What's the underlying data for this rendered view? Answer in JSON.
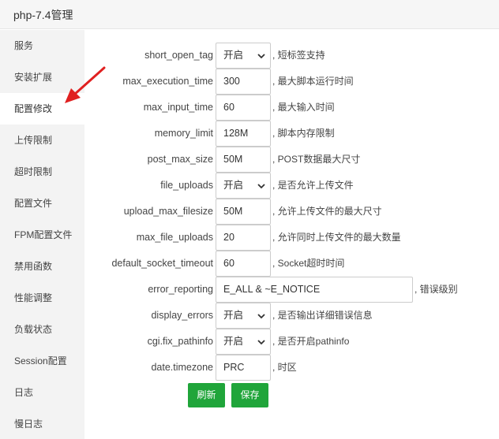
{
  "window": {
    "title": "php-7.4管理"
  },
  "sidebar": {
    "items": [
      {
        "label": "服务"
      },
      {
        "label": "安装扩展"
      },
      {
        "label": "配置修改"
      },
      {
        "label": "上传限制"
      },
      {
        "label": "超时限制"
      },
      {
        "label": "配置文件"
      },
      {
        "label": "FPM配置文件"
      },
      {
        "label": "禁用函数"
      },
      {
        "label": "性能调整"
      },
      {
        "label": "负载状态"
      },
      {
        "label": "Session配置"
      },
      {
        "label": "日志"
      },
      {
        "label": "慢日志"
      }
    ],
    "active_index": 2
  },
  "settings": [
    {
      "key": "short_open_tag",
      "value": "开启",
      "type": "select",
      "note": "短标签支持"
    },
    {
      "key": "max_execution_time",
      "value": "300",
      "type": "input",
      "note": "最大脚本运行时间"
    },
    {
      "key": "max_input_time",
      "value": "60",
      "type": "input",
      "note": "最大输入时间"
    },
    {
      "key": "memory_limit",
      "value": "128M",
      "type": "input",
      "note": "脚本内存限制"
    },
    {
      "key": "post_max_size",
      "value": "50M",
      "type": "input",
      "note": "POST数据最大尺寸"
    },
    {
      "key": "file_uploads",
      "value": "开启",
      "type": "select",
      "note": "是否允许上传文件"
    },
    {
      "key": "upload_max_filesize",
      "value": "50M",
      "type": "input",
      "note": "允许上传文件的最大尺寸"
    },
    {
      "key": "max_file_uploads",
      "value": "20",
      "type": "input",
      "note": "允许同时上传文件的最大数量"
    },
    {
      "key": "default_socket_timeout",
      "value": "60",
      "type": "input",
      "note": "Socket超时时间"
    },
    {
      "key": "error_reporting",
      "value": "E_ALL & ~E_NOTICE",
      "type": "wide",
      "note": "错误级别"
    },
    {
      "key": "display_errors",
      "value": "开启",
      "type": "select",
      "note": "是否输出详细错误信息"
    },
    {
      "key": "cgi.fix_pathinfo",
      "value": "开启",
      "type": "select",
      "note": "是否开启pathinfo"
    },
    {
      "key": "date.timezone",
      "value": "PRC",
      "type": "input",
      "note": "时区"
    }
  ],
  "buttons": {
    "refresh": "刷新",
    "save": "保存"
  },
  "colors": {
    "accent": "#20a53a",
    "arrow": "#e02020"
  }
}
